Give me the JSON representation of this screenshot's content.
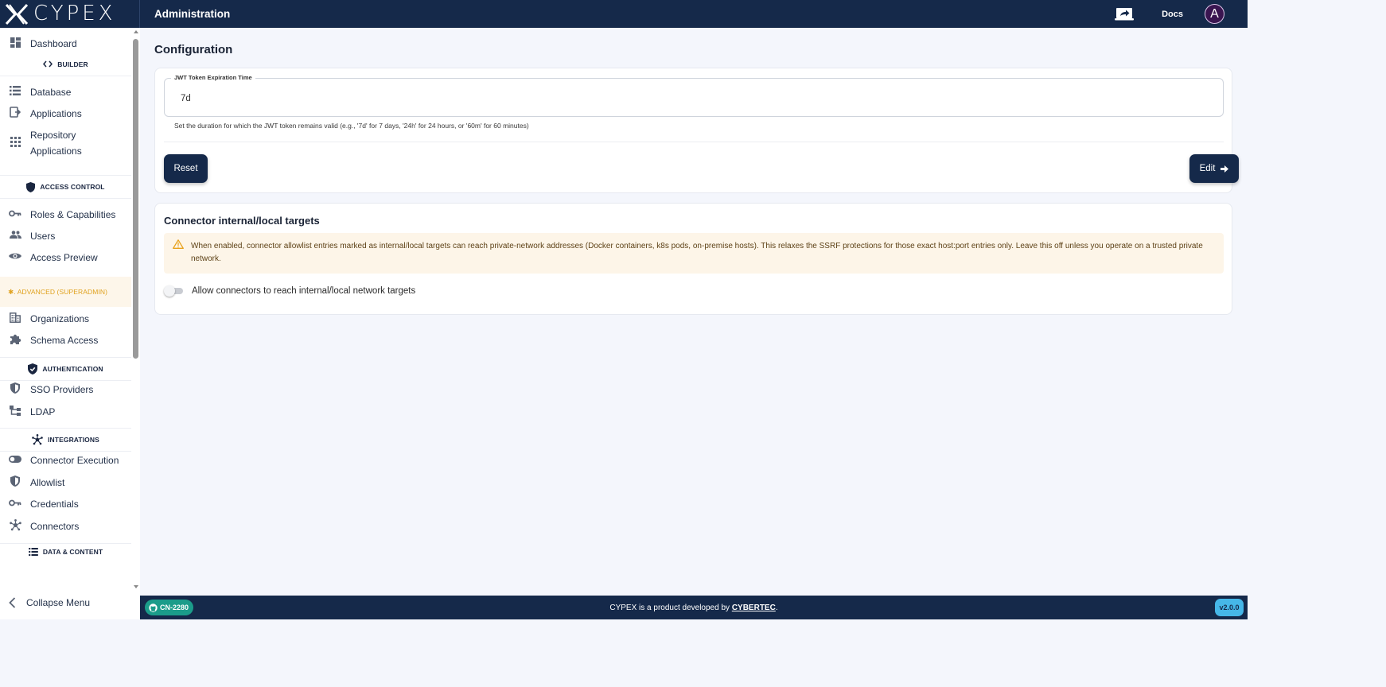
{
  "header": {
    "logo_text": "CYPEX",
    "title": "Administration",
    "docs_label": "Docs",
    "avatar_letter": "A"
  },
  "sidebar": {
    "dashboard": "Dashboard",
    "sections": {
      "builder": "BUILDER",
      "access_control": "ACCESS CONTROL",
      "advanced": "ADVANCED (SUPERADMIN)",
      "authentication": "AUTHENTICATION",
      "integrations": "INTEGRATIONS",
      "data_content": "DATA & CONTENT"
    },
    "items": {
      "database": "Database",
      "applications": "Applications",
      "repository_applications": "Repository Applications",
      "roles": "Roles & Capabilities",
      "users": "Users",
      "access_preview": "Access Preview",
      "organizations": "Organizations",
      "schema_access": "Schema Access",
      "sso_providers": "SSO Providers",
      "ldap": "LDAP",
      "connector_execution": "Connector Execution",
      "allowlist": "Allowlist",
      "credentials": "Credentials",
      "connectors": "Connectors"
    },
    "collapse_label": "Collapse Menu",
    "advanced_prefix": "✱."
  },
  "main": {
    "page_title": "Configuration",
    "config": {
      "jwt_label": "JWT Token Expiration Time",
      "jwt_value": "7d",
      "jwt_help": "Set the duration for which the JWT token remains valid (e.g., '7d' for 7 days, '24h' for 24 hours, or '60m' for 60 minutes)",
      "reset_label": "Reset",
      "edit_label": "Edit"
    },
    "connector": {
      "title": "Connector internal/local targets",
      "warning": "When enabled, connector allowlist entries marked as internal/local targets can reach private-network addresses (Docker containers, k8s pods, on-premise hosts). This relaxes the SSRF protections for those exact host:port entries only. Leave this off unless you operate on a trusted private network.",
      "toggle_label": "Allow connectors to reach internal/local network targets",
      "toggle_on": false
    }
  },
  "footer": {
    "branch": "CN-2280",
    "text_prefix": "CYPEX is a product developed by ",
    "brand": "CYBERTEC",
    "text_suffix": ".",
    "version": "v2.0.0"
  },
  "colors": {
    "header_bg": "#15294a",
    "accent_teal": "#1b9c8a",
    "version_badge": "#46b7e8",
    "warning_bg": "#fdf5e8",
    "warning_icon": "#e8a21c"
  }
}
